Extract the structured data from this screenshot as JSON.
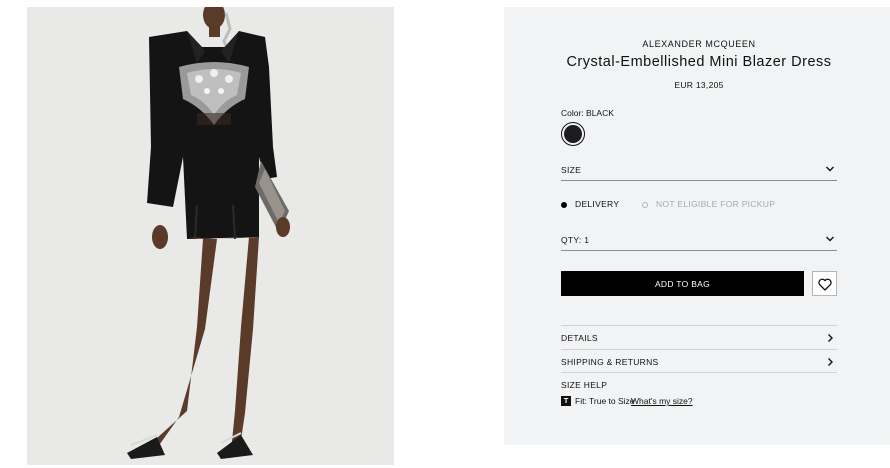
{
  "product": {
    "brand": "ALEXANDER MCQUEEN",
    "name": "Crystal-Embellished Mini Blazer Dress",
    "price": "EUR 13,205"
  },
  "color": {
    "label": "Color: BLACK",
    "swatch_hex": "#1c1c22"
  },
  "size_select": {
    "label": "SIZE",
    "icon": "chevron-down-icon"
  },
  "fulfillment": {
    "delivery_label": "DELIVERY",
    "pickup_label": "NOT ELIGIBLE FOR PICKUP"
  },
  "qty_select": {
    "label": "QTY: 1",
    "icon": "chevron-down-icon"
  },
  "actions": {
    "add_to_bag_label": "ADD TO BAG",
    "wishlist_icon": "heart-icon"
  },
  "accordions": [
    {
      "label": "DETAILS",
      "icon": "chevron-right-icon"
    },
    {
      "label": "SHIPPING & RETURNS",
      "icon": "chevron-right-icon"
    }
  ],
  "size_help": {
    "heading": "SIZE HELP",
    "fit_icon_letter": "T",
    "fit_text": "Fit: True to Size",
    "fit_link": "What's my size?"
  },
  "colors": {
    "panel_bg": "#f2f3f4",
    "button_bg": "#000000",
    "image_bg": "#e9e9e7"
  }
}
